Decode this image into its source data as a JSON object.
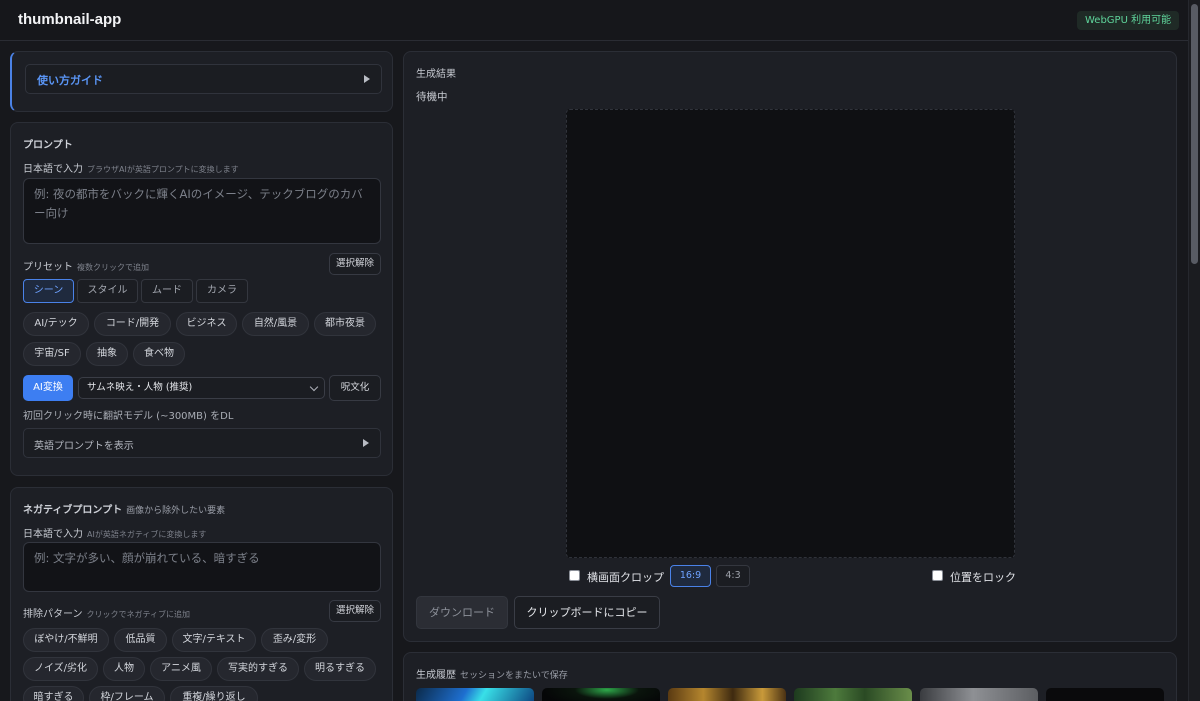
{
  "app": {
    "title": "thumbnail-app",
    "webgpu_badge": "WebGPU 利用可能"
  },
  "guide": {
    "label": "使い方ガイド"
  },
  "prompt": {
    "title": "プロンプト",
    "jp_label": "日本語で入力",
    "jp_hint": "ブラウザAIが英語プロンプトに変換します",
    "placeholder_line1": "例: 夜の都市をバックに輝くAIのイメージ、テックブログのカバ",
    "placeholder_line2": "ー向け",
    "preset_label": "プリセット",
    "preset_hint": "複数クリックで追加",
    "clear_button": "選択解除",
    "tabs": [
      "シーン",
      "スタイル",
      "ムード",
      "カメラ"
    ],
    "chips": [
      "AI/テック",
      "コード/開発",
      "ビジネス",
      "自然/風景",
      "都市夜景",
      "宇宙/SF",
      "抽象",
      "食べ物"
    ],
    "ai_button": "AI変換",
    "mode_select": "サムネ映え・人物 (推奨)",
    "spell_button": "呪文化",
    "model_note": "初回クリック時に翻訳モデル (~300MB) をDL",
    "show_english": "英語プロンプトを表示"
  },
  "negative": {
    "title": "ネガティブプロンプト",
    "subtitle": "画像から除外したい要素",
    "jp_label": "日本語で入力",
    "jp_hint": "AIが英語ネガティブに変換します",
    "placeholder": "例: 文字が多い、顔が崩れている、暗すぎる",
    "pattern_label": "排除パターン",
    "pattern_hint": "クリックでネガティブに追加",
    "clear_button": "選択解除",
    "chips": [
      "ぼやけ/不鮮明",
      "低品質",
      "文字/テキスト",
      "歪み/変形",
      "ノイズ/劣化",
      "人物",
      "アニメ風",
      "写実的すぎる",
      "明るすぎる",
      "暗すぎる",
      "枠/フレーム",
      "重複/繰り返し"
    ]
  },
  "result": {
    "title": "生成結果",
    "status": "待機中",
    "crop_label": "横画面クロップ",
    "ratio_options": [
      "16:9",
      "4:3"
    ],
    "lock_label": "位置をロック",
    "download_button": "ダウンロード",
    "copy_button": "クリップボードにコピー"
  },
  "history": {
    "title": "生成履歴",
    "subtitle": "セッションをまたいで保存"
  },
  "colors": {
    "accent": "#3d7ef2",
    "badge_green": "#5fd49b",
    "background": "#17181c"
  }
}
